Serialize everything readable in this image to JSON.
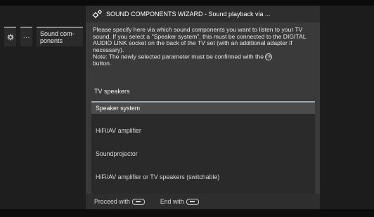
{
  "nav": {
    "gear_icon": "gear-icon",
    "dots_label": "···",
    "crumb_label": "Sound com- ponents"
  },
  "dialog": {
    "title": "SOUND COMPONENTS WIZARD - Sound playback via ...",
    "title_icon": "gears-icon",
    "description": "Please specify here via which sound components you want to listen to your TV sound. If you select a \"Speaker system\", this must be connected to the DIGITAL AUDIO LINK socket on the back of the TV set (with an additional adapter if necessary).",
    "note": "Note: The newly selected parameter must be confirmed with the",
    "note_end": "button.",
    "current_value": "TV speakers",
    "options": [
      {
        "label": "Speaker system",
        "selected": true
      },
      {
        "label": "HiFi/AV amplifier",
        "selected": false
      },
      {
        "label": "Soundprojector",
        "selected": false
      },
      {
        "label": "HiFi/AV amplifier or TV speakers (switchable)",
        "selected": false
      }
    ],
    "footer": {
      "proceed_label": "Proceed with",
      "end_label": "End with"
    }
  },
  "colors": {
    "background": "#161616",
    "dialog": "#3a3a3a",
    "selection": "#4b4b4b",
    "accent_line": "#9aa7b2"
  }
}
